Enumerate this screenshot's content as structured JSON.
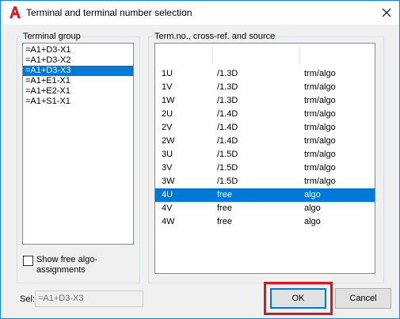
{
  "window": {
    "title": "Terminal and terminal number selection",
    "icon": "app-logo-icon",
    "close_icon": "close-icon",
    "border_color": "#1883d7"
  },
  "terminal_group": {
    "label": "Terminal group",
    "items": [
      {
        "label": "=A1+D3-X1",
        "selected": false
      },
      {
        "label": "=A1+D3-X2",
        "selected": false
      },
      {
        "label": "=A1+D3-X3",
        "selected": true
      },
      {
        "label": "=A1+E1-X1",
        "selected": false
      },
      {
        "label": "=A1+E2-X1",
        "selected": false
      },
      {
        "label": "=A1+S1-X1",
        "selected": false
      }
    ]
  },
  "show_free": {
    "label": "Show free algo-assignments",
    "checked": false
  },
  "term_table": {
    "label": "Term.no., cross-ref. and source",
    "rows": [
      {
        "term": "1U",
        "ref": "/1.3D",
        "source": "trm/algo",
        "selected": false
      },
      {
        "term": "1V",
        "ref": "/1.3D",
        "source": "trm/algo",
        "selected": false
      },
      {
        "term": "1W",
        "ref": "/1.3D",
        "source": "trm/algo",
        "selected": false
      },
      {
        "term": "2U",
        "ref": "/1.4D",
        "source": "trm/algo",
        "selected": false
      },
      {
        "term": "2V",
        "ref": "/1.4D",
        "source": "trm/algo",
        "selected": false
      },
      {
        "term": "2W",
        "ref": "/1.4D",
        "source": "trm/algo",
        "selected": false
      },
      {
        "term": "3U",
        "ref": "/1.5D",
        "source": "trm/algo",
        "selected": false
      },
      {
        "term": "3V",
        "ref": "/1.5D",
        "source": "trm/algo",
        "selected": false
      },
      {
        "term": "3W",
        "ref": "/1.5D",
        "source": "trm/algo",
        "selected": false
      },
      {
        "term": "4U",
        "ref": "free",
        "source": "algo",
        "selected": true
      },
      {
        "term": "4V",
        "ref": "free",
        "source": "algo",
        "selected": false
      },
      {
        "term": "4W",
        "ref": "free",
        "source": "algo",
        "selected": false
      }
    ]
  },
  "sel": {
    "label": "Sel:",
    "value": "=A1+D3-X3"
  },
  "buttons": {
    "ok": "OK",
    "cancel": "Cancel"
  },
  "colors": {
    "selection": "#0078d7",
    "highlight": "#e0141e"
  }
}
